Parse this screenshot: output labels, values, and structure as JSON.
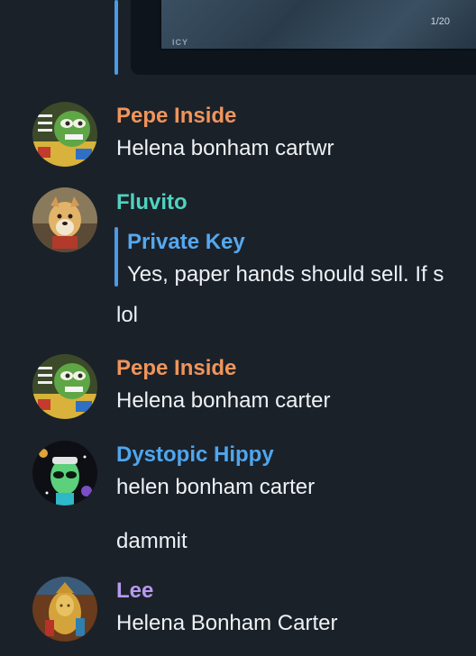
{
  "colors": {
    "background": "#1b2129",
    "pepe": "#f0955a",
    "fluvito": "#4fd3c0",
    "dystopic": "#4fa6ee",
    "lee": "#b79af0",
    "reply_name": "#55a8f0",
    "reply_bar": "#4c9ae6"
  },
  "previous_card": {
    "mark": "ICY",
    "page": "1/20"
  },
  "messages": [
    {
      "avatar_icon": "pepe-avatar-icon",
      "name": "Pepe Inside",
      "text": "Helena bonham cartwr"
    },
    {
      "avatar_icon": "doge-avatar-icon",
      "name": "Fluvito",
      "reply": {
        "name": "Private Key",
        "text": "Yes, paper hands should sell. If s"
      },
      "text": "lol"
    },
    {
      "avatar_icon": "pepe-avatar-icon",
      "name": "Pepe Inside",
      "text": "Helena bonham carter"
    },
    {
      "avatar_icon": "alien-avatar-icon",
      "name": "Dystopic Hippy",
      "text": "helen bonham carter",
      "text2": "dammit"
    },
    {
      "avatar_icon": "golden-statue-avatar-icon",
      "name": "Lee",
      "text": "Helena Bonham Carter"
    }
  ]
}
